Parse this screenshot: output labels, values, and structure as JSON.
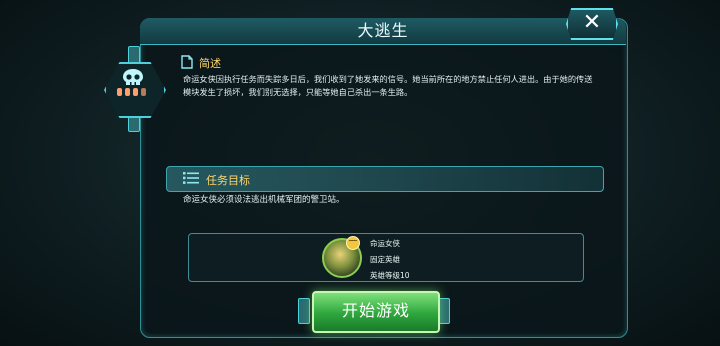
{
  "window": {
    "title": "大逃生",
    "close_label": "✕"
  },
  "summary": {
    "label": "简述",
    "text": "命运女侠因执行任务而失踪多日后，我们收到了她发来的信号。她当前所在的地方禁止任何人进出。由于她的传送模块发生了损坏，我们别无选择，只能等她自己杀出一条生路。"
  },
  "goal": {
    "label": "任务目标",
    "text": "命运女侠必须设法逃出机械军团的警卫站。"
  },
  "hero": {
    "badge": "一",
    "name": "命运女侠",
    "type": "固定英雄",
    "level": "英雄等级10"
  },
  "actions": {
    "start_label": "开始游戏"
  },
  "colors": {
    "accent": "#4fd0da",
    "label": "#ffd66a",
    "start": "#2da63c"
  }
}
